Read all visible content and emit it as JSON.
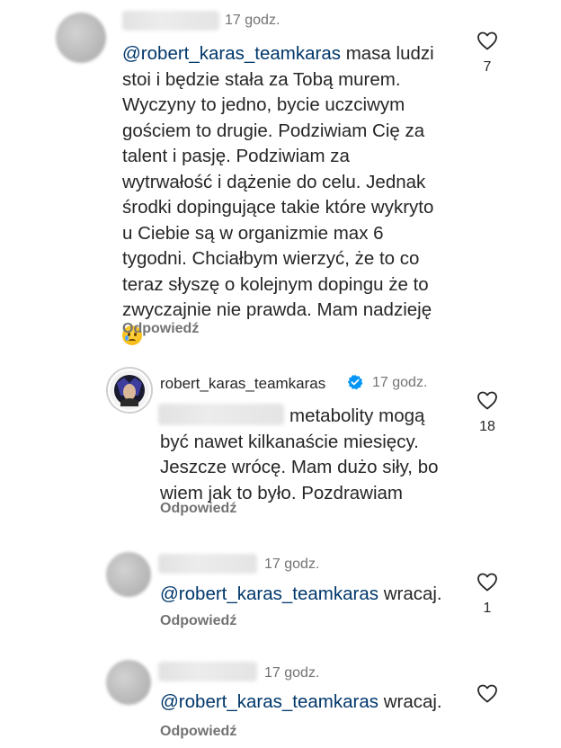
{
  "comments": [
    {
      "time": "17 godz.",
      "mention": "@robert_karas_teamkaras",
      "lines": [
        " masa ludzi",
        "stoi i będzie stała za Tobą murem.",
        "Wyczyny to jedno, bycie uczciwym",
        "gościem to drugie. Podziwiam Cię za",
        "talent i pasję. Podziwiam za",
        "wytrwałość i dążenie do celu. Jednak",
        "środki dopingujące takie które wykryto",
        "u Ciebie są w organizmie max 6",
        "tygodni. Chciałbym wierzyć, że to co",
        "teraz słyszę o kolejnym dopingu że to",
        "zwyczajnie nie prawda. Mam nadzieję"
      ],
      "emoji": "crying-face-emoji",
      "reply_label": "Odpowiedź",
      "likes": "7"
    },
    {
      "username": "robert_karas_teamkaras",
      "time": "17 godz.",
      "lines": [
        "metabolity mogą",
        "być nawet kilkanaście miesięcy.",
        "Jeszcze wrócę. Mam dużo siły, bo",
        "wiem jak to było. Pozdrawiam"
      ],
      "reply_label": "Odpowiedź",
      "likes": "18"
    },
    {
      "time": "17 godz.",
      "mention": "@robert_karas_teamkaras",
      "text": " wracaj.",
      "reply_label": "Odpowiedź",
      "likes": "1"
    },
    {
      "time": "17 godz.",
      "mention": "@robert_karas_teamkaras",
      "text": " wracaj.",
      "reply_label": "Odpowiedź"
    }
  ],
  "colors": {
    "mention": "#00376b",
    "muted": "#737373",
    "text": "#262626",
    "verified": "#0095f6"
  },
  "icons": {
    "heart": "heart-outline-icon",
    "verified": "verified-badge-icon"
  }
}
